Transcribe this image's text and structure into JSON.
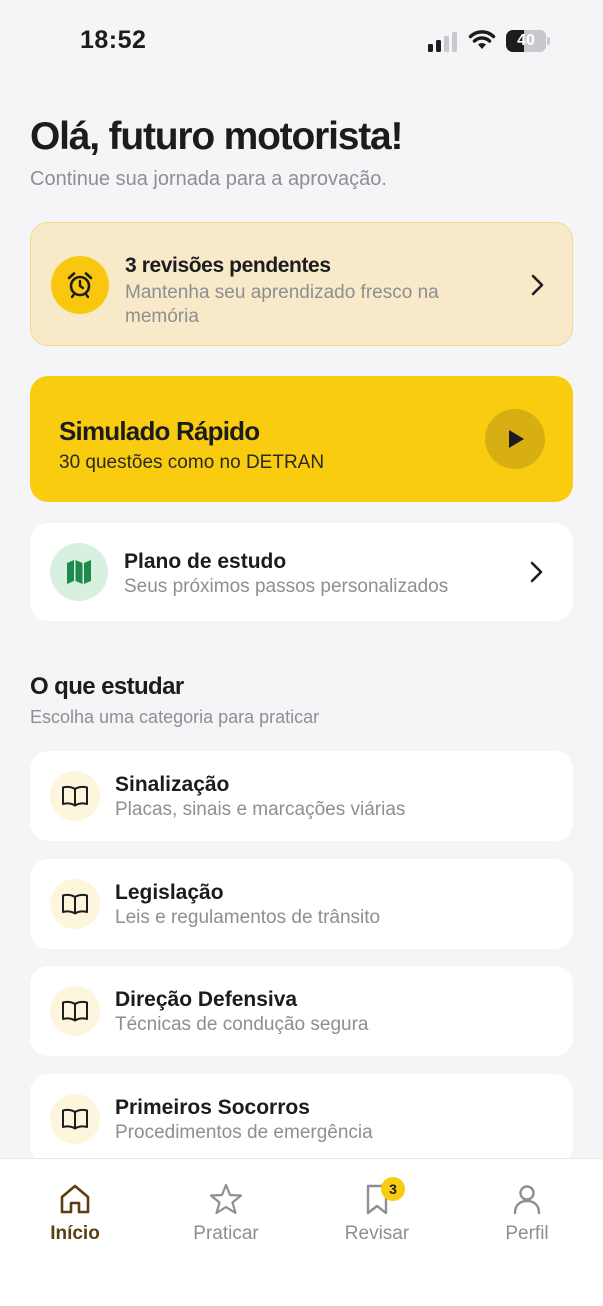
{
  "status_bar": {
    "time": "18:52",
    "battery": "40"
  },
  "header": {
    "greeting": "Olá, futuro motorista!",
    "subtitle": "Continue sua jornada para a aprovação."
  },
  "review_card": {
    "title": "3 revisões pendentes",
    "subtitle": "Mantenha seu aprendizado fresco na memória",
    "icon": "alarm-clock-icon"
  },
  "quick_test": {
    "title": "Simulado Rápido",
    "subtitle": "30 questões como no DETRAN",
    "icon": "play-icon"
  },
  "study_plan": {
    "title": "Plano de estudo",
    "subtitle": "Seus próximos passos personalizados",
    "icon": "map-icon"
  },
  "section": {
    "title": "O que estudar",
    "subtitle": "Escolha uma categoria para praticar"
  },
  "categories": [
    {
      "title": "Sinalização",
      "subtitle": "Placas, sinais e marcações viárias"
    },
    {
      "title": "Legislação",
      "subtitle": "Leis e regulamentos de trânsito"
    },
    {
      "title": "Direção Defensiva",
      "subtitle": "Técnicas de condução segura"
    },
    {
      "title": "Primeiros Socorros",
      "subtitle": "Procedimentos de emergência"
    }
  ],
  "tab_bar": {
    "tabs": [
      {
        "label": "Início",
        "icon": "home-icon",
        "active": true
      },
      {
        "label": "Praticar",
        "icon": "star-icon",
        "active": false
      },
      {
        "label": "Revisar",
        "icon": "bookmark-icon",
        "active": false,
        "badge": "3"
      },
      {
        "label": "Perfil",
        "icon": "user-icon",
        "active": false
      }
    ]
  },
  "colors": {
    "accent_yellow": "#f9cc0f",
    "review_bg": "#f8e9c9",
    "plan_icon_bg": "#d8f0df",
    "plan_icon": "#1e8a4c",
    "active_tab": "#5a3e12",
    "muted_text": "#8e8e93",
    "background": "#f5f5f7"
  }
}
